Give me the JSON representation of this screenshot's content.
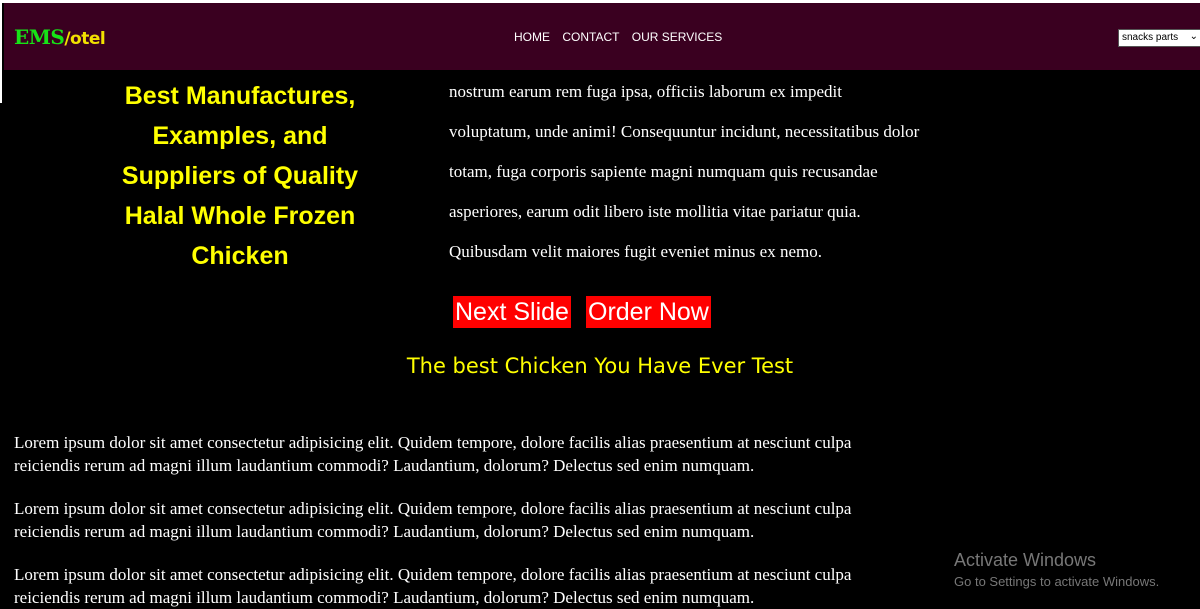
{
  "header": {
    "logo_main": "EMS",
    "logo_sub": "/otel",
    "nav": [
      "HOME",
      "CONTACT",
      "OUR SERVICES"
    ],
    "select_value": "snacks parts"
  },
  "hero": {
    "title": "Best Manufactures, Examples, and Suppliers of Quality Halal Whole Frozen Chicken",
    "text_lines": [
      "nostrum earum rem fuga ipsa, officiis laborum ex impedit",
      "voluptatum, unde animi! Consequuntur incidunt, necessitatibus dolor",
      "totam, fuga corporis sapiente magni numquam quis recusandae",
      "asperiores, earum odit libero iste mollitia vitae pariatur quia.",
      "Quibusdam velit maiores fugit eveniet minus ex nemo."
    ],
    "next_button": "Next Slide",
    "order_button": "Order Now"
  },
  "subheading": "The best Chicken You Have Ever Test",
  "paragraphs": [
    "Lorem ipsum dolor sit amet consectetur adipisicing elit. Quidem tempore, dolore facilis alias praesentium at nesciunt culpa reiciendis rerum ad magni illum laudantium commodi? Laudantium, dolorum? Delectus sed enim numquam.",
    "Lorem ipsum dolor sit amet consectetur adipisicing elit. Quidem tempore, dolore facilis alias praesentium at nesciunt culpa reiciendis rerum ad magni illum laudantium commodi? Laudantium, dolorum? Delectus sed enim numquam.",
    "Lorem ipsum dolor sit amet consectetur adipisicing elit. Quidem tempore, dolore facilis alias praesentium at nesciunt culpa reiciendis rerum ad magni illum laudantium commodi? Laudantium, dolorum? Delectus sed enim numquam."
  ],
  "watermark": {
    "title": "Activate Windows",
    "subtitle": "Go to Settings to activate Windows."
  },
  "colors": {
    "header_bg": "#3a0020",
    "accent_yellow": "#ffff00",
    "logo_green": "#17e317",
    "button_red": "#ff0000"
  }
}
